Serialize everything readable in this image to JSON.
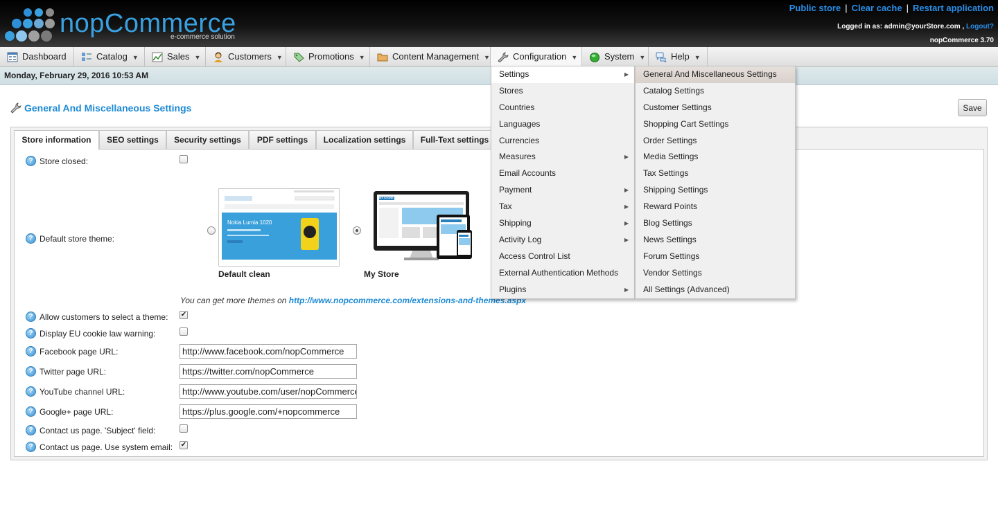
{
  "header": {
    "logo_name": "nopCommerce",
    "logo_tagline": "e-commerce solution",
    "links": [
      "Public store",
      "Clear cache",
      "Restart application"
    ],
    "logged_in_prefix": "Logged in as:",
    "logged_in_user": "admin@yourStore.com",
    "logout_label": "Logout?",
    "version": "nopCommerce 3.70"
  },
  "menu": {
    "items": [
      {
        "label": "Dashboard",
        "icon": "dashboard-icon"
      },
      {
        "label": "Catalog",
        "icon": "catalog-icon"
      },
      {
        "label": "Sales",
        "icon": "sales-chart-icon"
      },
      {
        "label": "Customers",
        "icon": "customer-icon"
      },
      {
        "label": "Promotions",
        "icon": "tag-icon"
      },
      {
        "label": "Content Management",
        "icon": "folder-icon"
      },
      {
        "label": "Configuration",
        "icon": "wrench-icon"
      },
      {
        "label": "System",
        "icon": "green-status-icon"
      },
      {
        "label": "Help",
        "icon": "chat-bubble-icon"
      }
    ],
    "caret": "▼"
  },
  "datebar": {
    "text": "Monday, February 29, 2016 10:53 AM"
  },
  "page": {
    "title": "General And Miscellaneous Settings",
    "save_label": "Save"
  },
  "tabs": [
    "Store information",
    "SEO settings",
    "Security settings",
    "PDF settings",
    "Localization settings",
    "Full-Text settings"
  ],
  "form": {
    "store_closed": {
      "label": "Store closed:",
      "checked": false
    },
    "default_theme": {
      "label": "Default store theme:",
      "themes": [
        {
          "name": "Default clean",
          "selected": false
        },
        {
          "name": "My Store",
          "selected": true
        }
      ],
      "preview_banner": "Nokia Lumia 1020",
      "preview_logo": "MY STORE"
    },
    "themes_note": "You can get more themes on",
    "themes_link": "http://www.nopcommerce.com/extensions-and-themes.aspx",
    "allow_select_theme": {
      "label": "Allow customers to select a theme:",
      "checked": true
    },
    "eu_cookie": {
      "label": "Display EU cookie law warning:",
      "checked": false
    },
    "facebook": {
      "label": "Facebook page URL:",
      "value": "http://www.facebook.com/nopCommerce"
    },
    "twitter": {
      "label": "Twitter page URL:",
      "value": "https://twitter.com/nopCommerce"
    },
    "youtube": {
      "label": "YouTube channel URL:",
      "value": "http://www.youtube.com/user/nopCommerce"
    },
    "googleplus": {
      "label": "Google+ page URL:",
      "value": "https://plus.google.com/+nopcommerce"
    },
    "contact_subject": {
      "label": "Contact us page. 'Subject' field:",
      "checked": false
    },
    "contact_system_email": {
      "label": "Contact us page. Use system email:",
      "checked": true
    },
    "help_glyph": "?",
    "check_glyph": "✔"
  },
  "config_menu": {
    "items": [
      {
        "label": "Settings",
        "has_sub": true
      },
      {
        "label": "Stores",
        "has_sub": false
      },
      {
        "label": "Countries",
        "has_sub": false
      },
      {
        "label": "Languages",
        "has_sub": false
      },
      {
        "label": "Currencies",
        "has_sub": false
      },
      {
        "label": "Measures",
        "has_sub": true
      },
      {
        "label": "Email Accounts",
        "has_sub": false
      },
      {
        "label": "Payment",
        "has_sub": true
      },
      {
        "label": "Tax",
        "has_sub": true
      },
      {
        "label": "Shipping",
        "has_sub": true
      },
      {
        "label": "Activity Log",
        "has_sub": true
      },
      {
        "label": "Access Control List",
        "has_sub": false
      },
      {
        "label": "External Authentication Methods",
        "has_sub": false
      },
      {
        "label": "Plugins",
        "has_sub": true
      }
    ],
    "arrow": "▶"
  },
  "settings_menu": {
    "items": [
      "General And Miscellaneous Settings",
      "Catalog Settings",
      "Customer Settings",
      "Shopping Cart Settings",
      "Order Settings",
      "Media Settings",
      "Tax Settings",
      "Shipping Settings",
      "Reward Points",
      "Blog Settings",
      "News Settings",
      "Forum Settings",
      "Vendor Settings",
      "All Settings (Advanced)"
    ]
  },
  "colors": {
    "accent": "#1e8ad4",
    "link": "#2a8ee8",
    "menu_highlight": "#d8d0cb"
  }
}
